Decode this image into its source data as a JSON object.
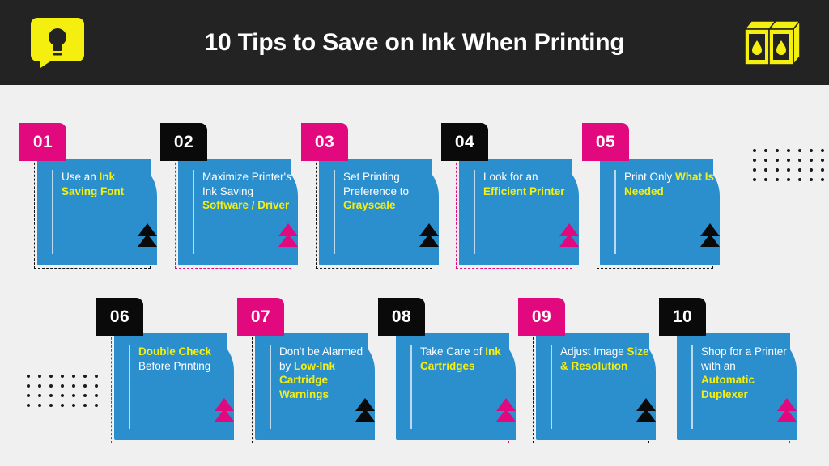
{
  "header": {
    "title": "10 Tips to Save on Ink When Printing",
    "left_icon": "lightbulb-speech-bubble-icon",
    "right_icon": "ink-cartridge-icon",
    "background_color": "#232323",
    "accent_color": "#F5EF10"
  },
  "theme": {
    "page_background": "#F0F0F0",
    "card_blue": "#2B8FCE",
    "pink": "#E2097F",
    "black": "#0A0A0A",
    "yellow": "#F5EF10",
    "white": "#FFFFFF"
  },
  "decor": {
    "dot_grid_rows": 4,
    "dot_grid_cols": 7,
    "dot_color": "#1B1B1B"
  },
  "cards": [
    {
      "number": "01",
      "badge_color": "#E2097F",
      "dash_color": "#111111",
      "triangle_color": "#0A0A0A",
      "lines": [
        {
          "text": "Use an ",
          "highlight": false
        },
        {
          "text": "Ink Saving Font",
          "highlight": true
        }
      ],
      "plain_text": "Use an Ink Saving Font"
    },
    {
      "number": "02",
      "badge_color": "#0A0A0A",
      "dash_color": "#E2097F",
      "triangle_color": "#E2097F",
      "lines": [
        {
          "text": "Maximize Printer's Ink Saving ",
          "highlight": false
        },
        {
          "text": "Software / Driver",
          "highlight": true
        }
      ],
      "plain_text": "Maximize Printer's Ink Saving Software / Driver"
    },
    {
      "number": "03",
      "badge_color": "#E2097F",
      "dash_color": "#111111",
      "triangle_color": "#0A0A0A",
      "lines": [
        {
          "text": "Set Printing Preference to ",
          "highlight": false
        },
        {
          "text": "Grayscale",
          "highlight": true
        }
      ],
      "plain_text": "Set Printing Preference to Grayscale"
    },
    {
      "number": "04",
      "badge_color": "#0A0A0A",
      "dash_color": "#E2097F",
      "triangle_color": "#E2097F",
      "lines": [
        {
          "text": "Look for an ",
          "highlight": false
        },
        {
          "text": "Efficient Printer",
          "highlight": true
        }
      ],
      "plain_text": "Look for an Efficient Printer"
    },
    {
      "number": "05",
      "badge_color": "#E2097F",
      "dash_color": "#111111",
      "triangle_color": "#0A0A0A",
      "lines": [
        {
          "text": "Print Only ",
          "highlight": false
        },
        {
          "text": "What Is Needed",
          "highlight": true
        }
      ],
      "plain_text": "Print Only What Is Needed"
    },
    {
      "number": "06",
      "badge_color": "#0A0A0A",
      "dash_color": "#E2097F",
      "triangle_color": "#E2097F",
      "lines": [
        {
          "text": "Double Check ",
          "highlight": true
        },
        {
          "text": "Before Printing",
          "highlight": false
        }
      ],
      "plain_text": "Double Check Before Printing"
    },
    {
      "number": "07",
      "badge_color": "#E2097F",
      "dash_color": "#111111",
      "triangle_color": "#0A0A0A",
      "lines": [
        {
          "text": "Don't be Alarmed by ",
          "highlight": false
        },
        {
          "text": "Low-Ink Cartridge Warnings",
          "highlight": true
        }
      ],
      "plain_text": "Don't be Alarmed by Low-Ink Cartridge Warnings"
    },
    {
      "number": "08",
      "badge_color": "#0A0A0A",
      "dash_color": "#E2097F",
      "triangle_color": "#E2097F",
      "lines": [
        {
          "text": "Take Care of ",
          "highlight": false
        },
        {
          "text": "Ink Cartridges",
          "highlight": true
        }
      ],
      "plain_text": "Take Care of Ink Cartridges"
    },
    {
      "number": "09",
      "badge_color": "#E2097F",
      "dash_color": "#111111",
      "triangle_color": "#0A0A0A",
      "lines": [
        {
          "text": "Adjust Image ",
          "highlight": false
        },
        {
          "text": "Size & Resolution",
          "highlight": true
        }
      ],
      "plain_text": "Adjust Image Size & Resolution"
    },
    {
      "number": "10",
      "badge_color": "#0A0A0A",
      "dash_color": "#E2097F",
      "triangle_color": "#E2097F",
      "lines": [
        {
          "text": "Shop for a Printer with an ",
          "highlight": false
        },
        {
          "text": "Automatic Duplexer",
          "highlight": true
        }
      ],
      "plain_text": "Shop for a Printer with an Automatic Duplexer"
    }
  ]
}
